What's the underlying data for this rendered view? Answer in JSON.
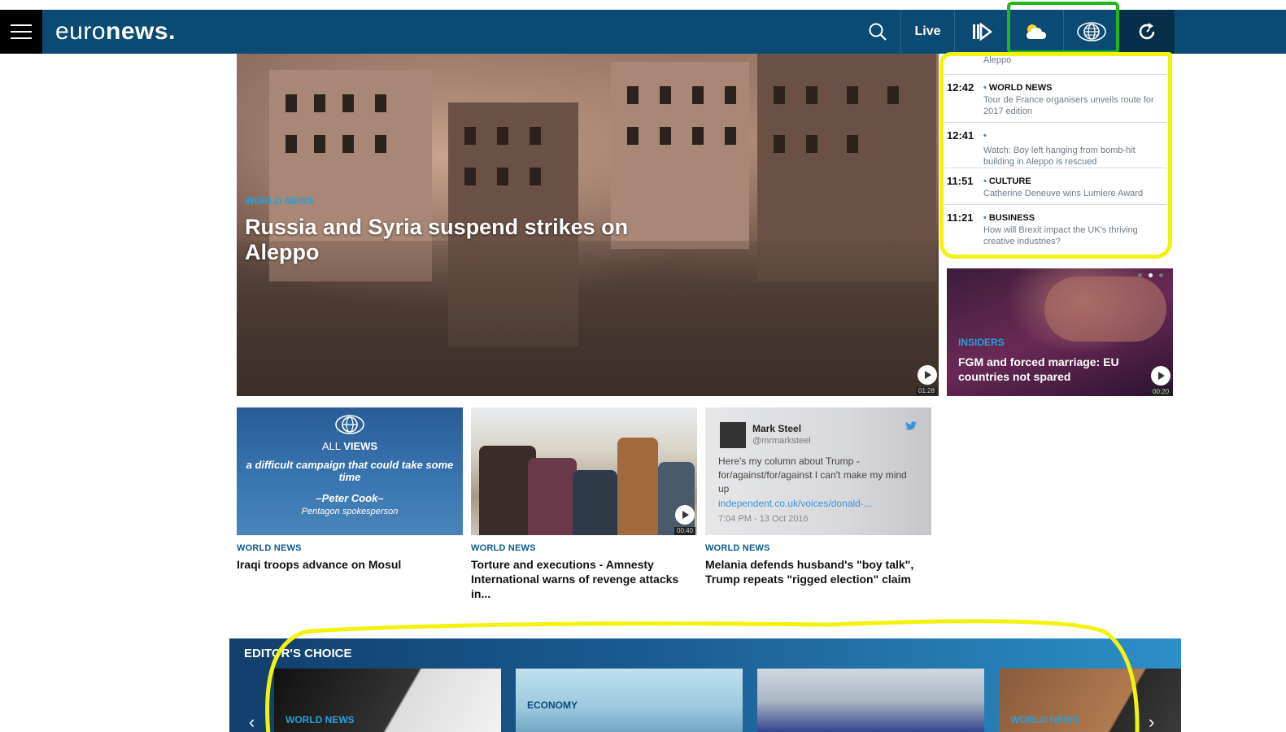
{
  "header": {
    "logo_light": "euro",
    "logo_bold": "news",
    "logo_dot": ".",
    "live_label": "Live",
    "icons": [
      "menu-icon",
      "search-icon",
      "feed-icon",
      "weather-icon",
      "globe-icon",
      "refresh-icon"
    ]
  },
  "hero": {
    "category": "WORLD NEWS",
    "title": "Russia and Syria suspend strikes on Aleppo",
    "duration": "01:28"
  },
  "latest": {
    "top_text": "Aleppo",
    "items": [
      {
        "time": "12:42",
        "category": "WORLD NEWS",
        "text": "Tour de France organisers unveils route for 2017 edition"
      },
      {
        "time": "12:41",
        "category": "",
        "text": "Watch: Boy left hanging from bomb-hit building in Aleppo is rescued"
      },
      {
        "time": "11:51",
        "category": "CULTURE",
        "text": "Catherine Deneuve wins Lumiere Award"
      },
      {
        "time": "11:21",
        "category": "BUSINESS",
        "text": "How will Brexit impact the UK's thriving creative industries?"
      }
    ]
  },
  "insiders": {
    "category": "INSIDERS",
    "title": "FGM and forced marriage: EU countries not spared",
    "duration": "00:20"
  },
  "allviews": {
    "label_light": "ALL",
    "label_bold": "VIEWS",
    "quote": "a difficult campaign that could take some time",
    "author": "–Peter Cook–",
    "role": "Pentagon spokesperson"
  },
  "photo_card": {
    "duration": "00:40"
  },
  "tweet": {
    "name": "Mark Steel",
    "handle": "@mrmarksteel",
    "text": "Here's my column about Trump - for/against/for/against I can't make my mind up",
    "link": "independent.co.uk/voices/donald-...",
    "time": "7:04 PM - 13 Oct 2016"
  },
  "stories": [
    {
      "category": "WORLD NEWS",
      "title": "Iraqi troops advance on Mosul"
    },
    {
      "category": "WORLD NEWS",
      "title": "Torture and executions - Amnesty International warns of revenge attacks in..."
    },
    {
      "category": "WORLD NEWS",
      "title": "Melania defends husband's \"boy talk\", Trump repeats \"rigged election\" claim"
    }
  ],
  "editors": {
    "title": "EDITOR'S CHOICE",
    "cards": [
      {
        "category": "WORLD NEWS"
      },
      {
        "category": "ECONOMY"
      },
      {
        "category": ""
      },
      {
        "category": "WORLD NEWS"
      }
    ]
  },
  "colors": {
    "header_bg": "#0b4a73",
    "accent": "#2a9fd6",
    "annotation_yellow": "#f2f20e",
    "annotation_green": "#1db91d"
  }
}
